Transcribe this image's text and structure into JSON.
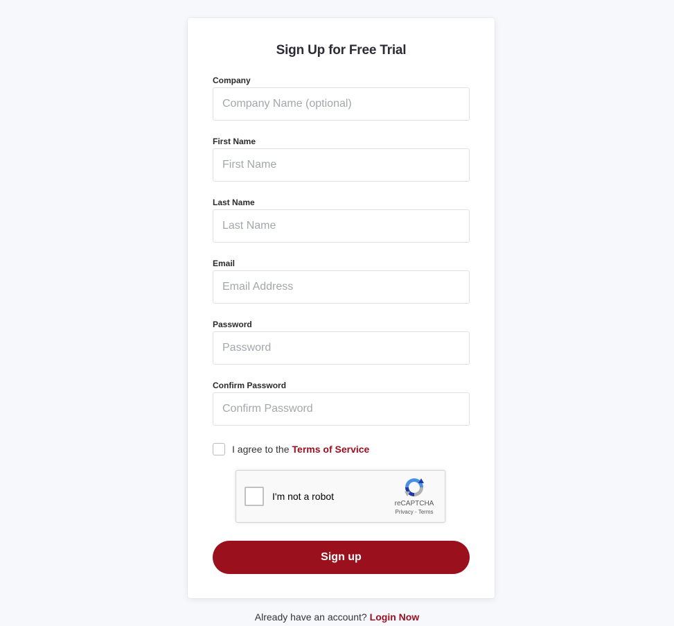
{
  "form": {
    "title": "Sign Up for Free Trial",
    "fields": [
      {
        "label": "Company",
        "placeholder": "Company Name (optional)",
        "value": ""
      },
      {
        "label": "First Name",
        "placeholder": "First Name",
        "value": ""
      },
      {
        "label": "Last Name",
        "placeholder": "Last Name",
        "value": ""
      },
      {
        "label": "Email",
        "placeholder": "Email Address",
        "value": ""
      },
      {
        "label": "Password",
        "placeholder": "Password",
        "value": ""
      },
      {
        "label": "Confirm Password",
        "placeholder": "Confirm Password",
        "value": ""
      }
    ],
    "agree": {
      "text": "I agree to the",
      "link": "Terms of Service",
      "checked": false
    },
    "recaptcha": {
      "label": "I'm not a robot",
      "brand": "reCAPTCHA",
      "links": "Privacy - Terms",
      "icon": "recaptcha-logo-icon"
    },
    "submit_label": "Sign up"
  },
  "footer": {
    "text": "Already have an account?",
    "link": "Login Now"
  },
  "colors": {
    "accent": "#9a101c",
    "background": "#f7f8fc"
  }
}
